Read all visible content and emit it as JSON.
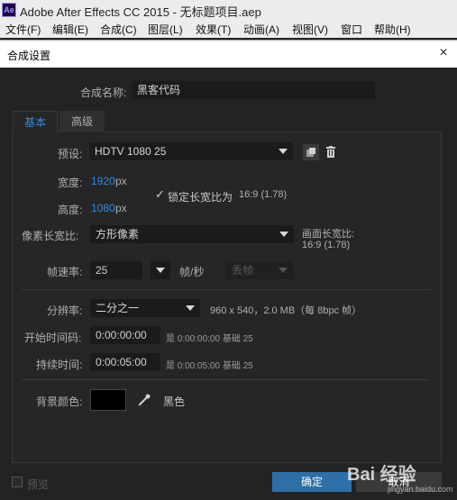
{
  "app": {
    "logo_text": "Ae",
    "title": "Adobe After Effects CC 2015 - 无标题项目.aep"
  },
  "menu": [
    {
      "label": "文件(F)"
    },
    {
      "label": "编辑(E)"
    },
    {
      "label": "合成(C)"
    },
    {
      "label": "图层(L)"
    },
    {
      "label": "效果(T)"
    },
    {
      "label": "动画(A)"
    },
    {
      "label": "视图(V)"
    },
    {
      "label": "窗口"
    },
    {
      "label": "帮助(H)"
    }
  ],
  "dialog": {
    "title": "合成设置",
    "close_icon": "×",
    "comp_name_label": "合成名称:",
    "comp_name_value": "黑客代码",
    "tabs": [
      {
        "label": "基本",
        "active": true
      },
      {
        "label": "高级",
        "active": false
      }
    ],
    "preset_label": "预设:",
    "preset_value": "HDTV 1080 25",
    "width_label": "宽度:",
    "width_value": "1920",
    "height_label": "高度:",
    "height_value": "1080",
    "unit_px": "px",
    "lock_checked": true,
    "lock_label": "锁定长宽比为",
    "lock_ratio": "16:9 (1.78)",
    "pixel_aspect_label": "像素长宽比:",
    "pixel_aspect_value": "方形像素",
    "frame_aspect_label": "画面长宽比:",
    "frame_aspect_value": "16:9 (1.78)",
    "frame_rate_label": "帧速率:",
    "frame_rate_value": "25",
    "fps_unit": "帧/秒",
    "drop_frame_value": "丢帧",
    "resolution_label": "分辨率:",
    "resolution_value": "二分之一",
    "resolution_info": "960 x 540，2.0 MB（每 8bpc 帧）",
    "start_tc_label": "开始时间码:",
    "start_tc_value": "0:00:00:00",
    "start_tc_info": "是 0:00:00:00  基础 25",
    "duration_label": "持续时间:",
    "duration_value": "0:00:05:00",
    "duration_info": "是 0:00:05:00  基础 25",
    "bg_color_label": "背景颜色:",
    "bg_color_hex": "#000000",
    "bg_color_name": "黑色",
    "preview_label": "预览",
    "ok_label": "确定",
    "cancel_label": "取消"
  },
  "watermark": {
    "text": "Bai 经验",
    "url": "jingyan.baidu.com"
  },
  "colors": {
    "accent": "#2d8ceb",
    "ok_button": "#2e6fa8",
    "background": "#232323"
  },
  "icons": [
    "save-preset-icon",
    "trash-icon",
    "eyedropper-icon",
    "close-icon",
    "chevron-down-icon",
    "checkmark-icon"
  ]
}
